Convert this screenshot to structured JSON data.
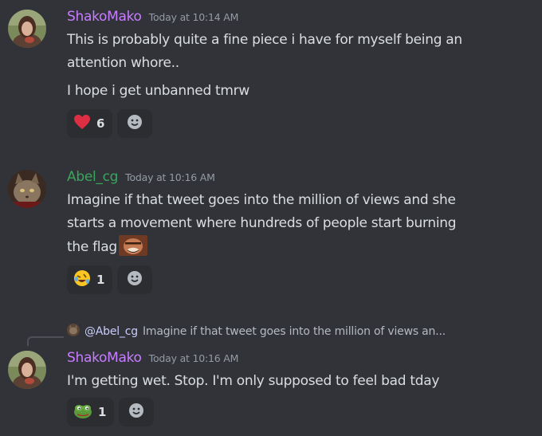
{
  "messages": [
    {
      "username": "ShakoMako",
      "username_color": "#c77dff",
      "timestamp": "Today at 10:14 AM",
      "lines": [
        "This is probably quite a fine piece i have for myself being an",
        "attention whore..",
        "I hope i get unbanned tmrw"
      ],
      "reactions": [
        {
          "emoji": "heart-emoji",
          "count": "6"
        }
      ]
    },
    {
      "username": "Abel_cg",
      "username_color": "#3ba55c",
      "timestamp": "Today at 10:16 AM",
      "lines": [
        "Imagine if that tweet goes into the million of views and she",
        "starts a movement where hundreds of people start burning",
        "the flag"
      ],
      "inline_emote": "laughing-man-emote",
      "reactions": [
        {
          "emoji": "rofl-emoji",
          "count": "1"
        }
      ]
    },
    {
      "reply": {
        "mention": "@Abel_cg",
        "text": "Imagine if that tweet goes into the million of views an..."
      },
      "username": "ShakoMako",
      "username_color": "#c77dff",
      "timestamp": "Today at 10:16 AM",
      "lines": [
        "I'm getting wet. Stop. I'm only supposed to feel bad tday"
      ],
      "reactions": [
        {
          "emoji": "pepe-emoji",
          "count": "1"
        }
      ]
    }
  ]
}
